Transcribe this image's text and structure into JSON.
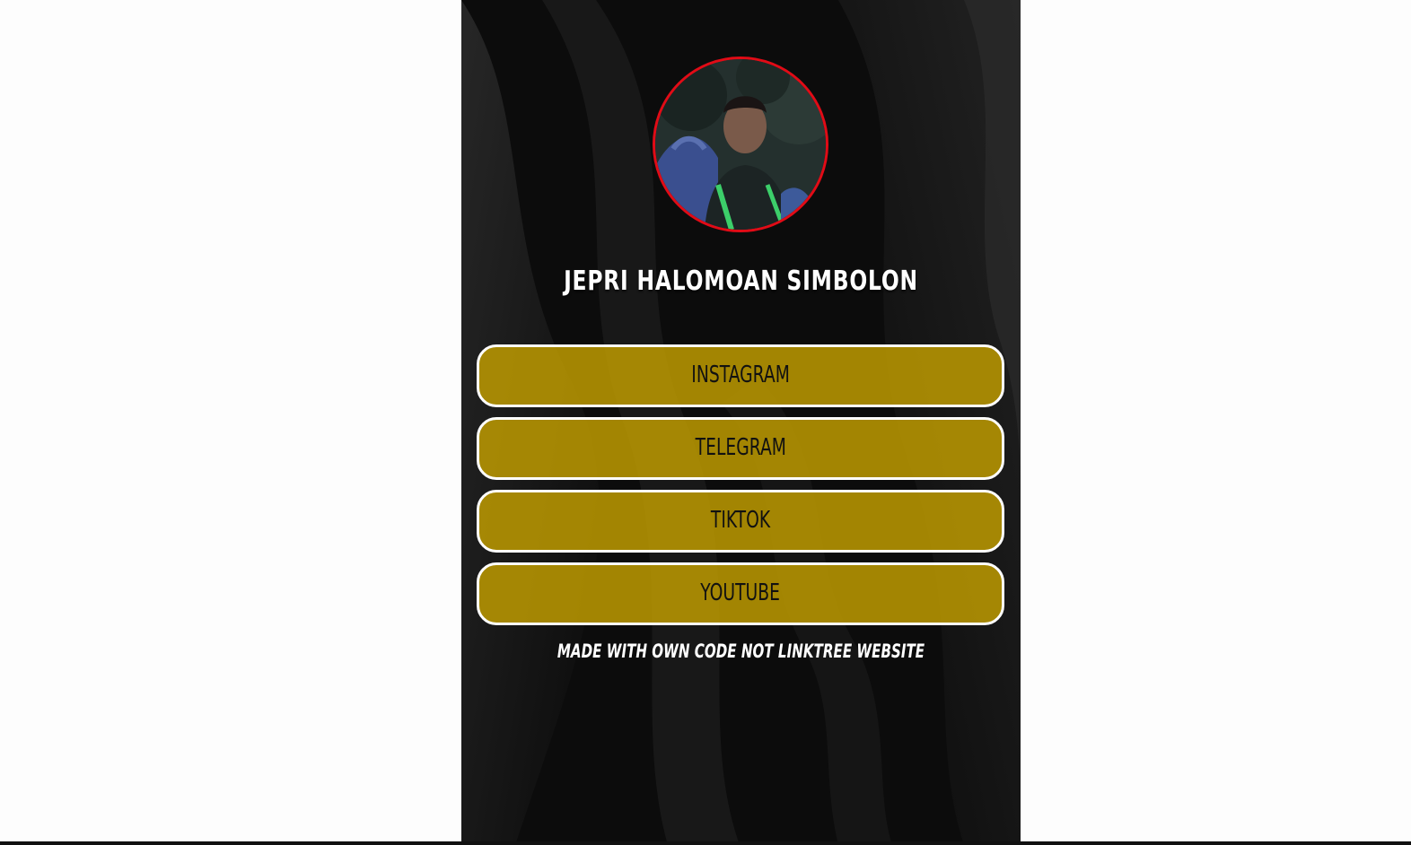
{
  "profile": {
    "name": "JEPRI HALOMOAN SIMBOLON",
    "avatar_border_color": "#e10b16"
  },
  "links": [
    {
      "label": "INSTAGRAM"
    },
    {
      "label": "TELEGRAM"
    },
    {
      "label": "TIKTOK"
    },
    {
      "label": "YOUTUBE"
    }
  ],
  "button_style": {
    "fill_color": "#a58a00",
    "border_color": "#ffffff",
    "text_color": "#111111"
  },
  "footer": {
    "note": "MADE WITH OWN CODE NOT LINKTREE WEBSITE"
  },
  "theme": {
    "panel_background": "#0b0b0b",
    "page_background": "#fdfdfd"
  }
}
